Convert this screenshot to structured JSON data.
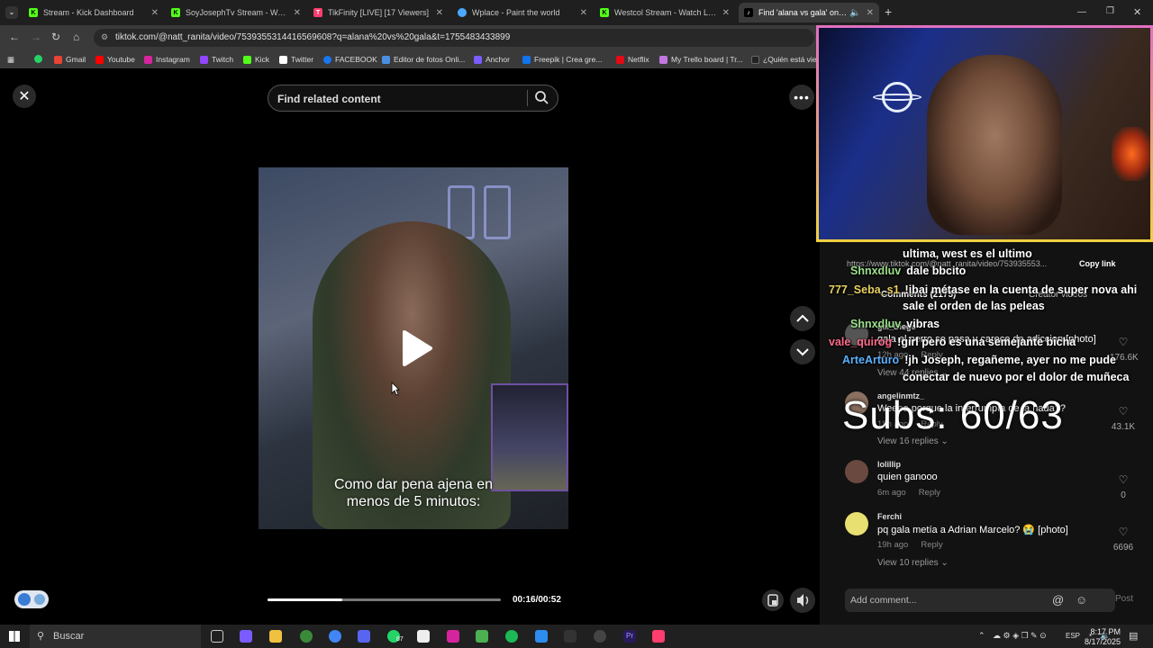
{
  "tabs": [
    {
      "label": "Stream - Kick Dashboard",
      "color": "#53fc18",
      "glyph": "K"
    },
    {
      "label": "SoyJosephTv Stream - Watch Li",
      "color": "#53fc18",
      "glyph": "K"
    },
    {
      "label": "TikFinity [LIVE] [17 Viewers]",
      "color": "#ff3d6e",
      "glyph": "T"
    },
    {
      "label": "Wplace - Paint the world",
      "color": "#4aa8ff",
      "glyph": "W"
    },
    {
      "label": "Westcol Stream - Watch Live or",
      "color": "#53fc18",
      "glyph": "K"
    },
    {
      "label": "Find 'alana vs gala' on TikTo",
      "color": "#ffffff",
      "glyph": "♪"
    }
  ],
  "address": {
    "url": "tiktok.com/@natt_ranita/video/7539355314416569608?q=alana%20vs%20gala&t=1755483433899"
  },
  "bookmarks": [
    "Gmail",
    "Youtube",
    "Instagram",
    "Twitch",
    "Kick",
    "Twitter",
    "FACEBOOK",
    "Editor de fotos Onli...",
    "Anchor",
    "Freepik | Crea gre...",
    "Netflix",
    "My Trello board | Tr...",
    "¿Quién está vien"
  ],
  "video": {
    "search_placeholder": "Find related content",
    "caption_line1": "Como dar pena ajena en",
    "caption_line2": "menos de 5 minutos:",
    "time": "00:16/00:52",
    "progress": 0.32
  },
  "panel": {
    "link_text": "https://www.tiktok.com/@natt_ranita/video/753935553...",
    "copy_link": "Copy link",
    "tab_comments": "Comments (2175)",
    "tab_creator": "Creator videos",
    "comments": [
      {
        "user": "gal_Diego",
        "text": "gala el perro se pasa y carece de adiccion [photo]",
        "meta": "12h ago",
        "reply": "Reply",
        "likes": "176.6K",
        "replies": "View 44 replies",
        "avatar": "#555"
      },
      {
        "user": "angelinmtz_",
        "text": "Weeee porque la interrumpía de la nada??",
        "meta": "18h ago",
        "reply": "Reply",
        "likes": "43.1K",
        "replies": "View 16 replies",
        "avatar": "#8a7060"
      },
      {
        "user": "lolillip",
        "text": "quien ganooo",
        "meta": "6m ago",
        "reply": "Reply",
        "likes": "0",
        "replies": "",
        "avatar": "#6a4a40"
      },
      {
        "user": "Ferchi",
        "text": "pq gala metía a Adrian Marcelo? 😭 [photo]",
        "meta": "19h ago",
        "reply": "Reply",
        "likes": "6696",
        "replies": "View 10 replies",
        "avatar": "#e8e070"
      }
    ],
    "add_comment": "Add comment...",
    "post": "Post"
  },
  "chat": [
    {
      "user": "",
      "msg": "ultima, west es el ultimo",
      "color": "#ffffff"
    },
    {
      "user": "Shnxdluv",
      "msg": "dale bbcito",
      "color": "#9be08a"
    },
    {
      "user": "777_Seba_s1",
      "msg": "!ibai métase en la cuenta de super nova ahi",
      "color": "#e8d060"
    },
    {
      "user": "",
      "msg": "sale el orden de las peleas",
      "color": "#ffffff"
    },
    {
      "user": "Shnxdluv",
      "msg": "vibras",
      "color": "#9be08a"
    },
    {
      "user": "vale_quirog",
      "msg": "!girl pero es una semejante bicha",
      "color": "#ff6a8a"
    },
    {
      "user": "ArteArturo",
      "msg": "!jh Joseph, regañeme, ayer no me pude",
      "color": "#5ab0ff"
    },
    {
      "user": "",
      "msg": "conectar de nuevo por el dolor de muñeca",
      "color": "#ffffff"
    }
  ],
  "subs": "Subs: 60/63",
  "taskbar": {
    "search": "Buscar",
    "time": "8:17 PM",
    "date": "8/17/2025",
    "lang": "ESP",
    "whatsapp_badge": "87"
  }
}
